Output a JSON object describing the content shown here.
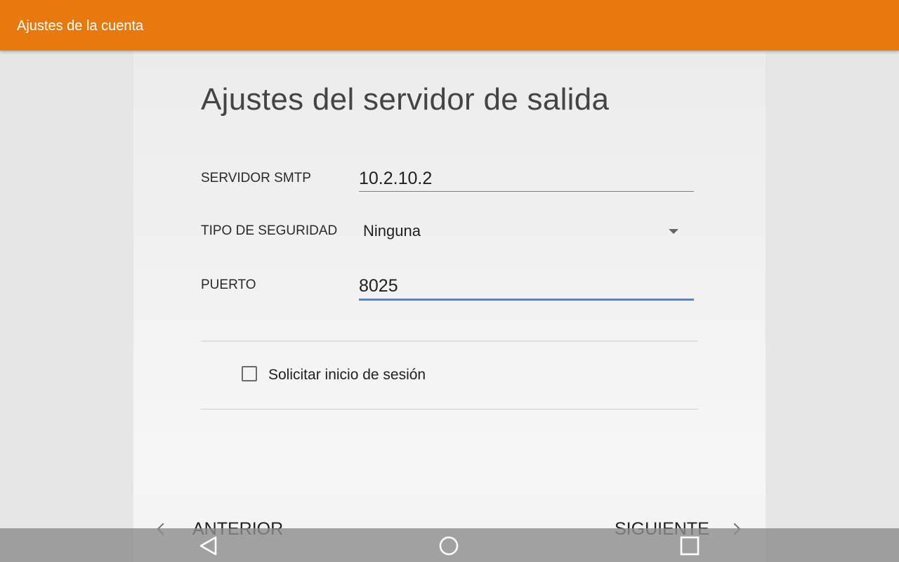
{
  "appbar": {
    "title": "Ajustes de la cuenta"
  },
  "page": {
    "title": "Ajustes del servidor de salida"
  },
  "form": {
    "smtp": {
      "label": "SERVIDOR SMTP",
      "value": "10.2.10.2"
    },
    "security": {
      "label": "TIPO DE SEGURIDAD",
      "value": "Ninguna"
    },
    "port": {
      "label": "PUERTO",
      "value": "8025"
    },
    "require_login": {
      "label": "Solicitar inicio de sesión",
      "checked": false
    }
  },
  "nav": {
    "previous_label": "ANTERIOR",
    "next_label": "SIGUIENTE"
  },
  "system_nav": {
    "icons": [
      "back-icon",
      "home-icon",
      "recents-icon"
    ]
  },
  "colors": {
    "appbar": "#e8790e",
    "focus_underline": "#4a86e0"
  }
}
